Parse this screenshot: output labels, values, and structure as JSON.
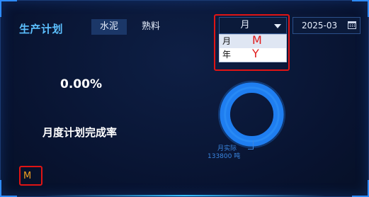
{
  "panel": {
    "title": "生产计划",
    "tabs": [
      {
        "label": "水泥",
        "active": true
      },
      {
        "label": "熟料",
        "active": false
      }
    ],
    "period_select": {
      "value": "月",
      "options": [
        {
          "label": "月",
          "annotation": "M"
        },
        {
          "label": "年",
          "annotation": "Y"
        }
      ]
    },
    "date_picker": {
      "value": "2025-03",
      "icon": "calendar-icon"
    }
  },
  "stats": {
    "completion_pct": "0.00%",
    "completion_label": "月度计划完成率",
    "actual_label": "月实际",
    "actual_value": "133800 吨",
    "completion_fraction": 0.0
  },
  "bottom_badge": "M",
  "colors": {
    "accent": "#2e8cff",
    "title": "#5cc0ff",
    "annotation_red": "#e01414",
    "badge_orange": "#f0a020",
    "ring": "#1f7ef0"
  }
}
